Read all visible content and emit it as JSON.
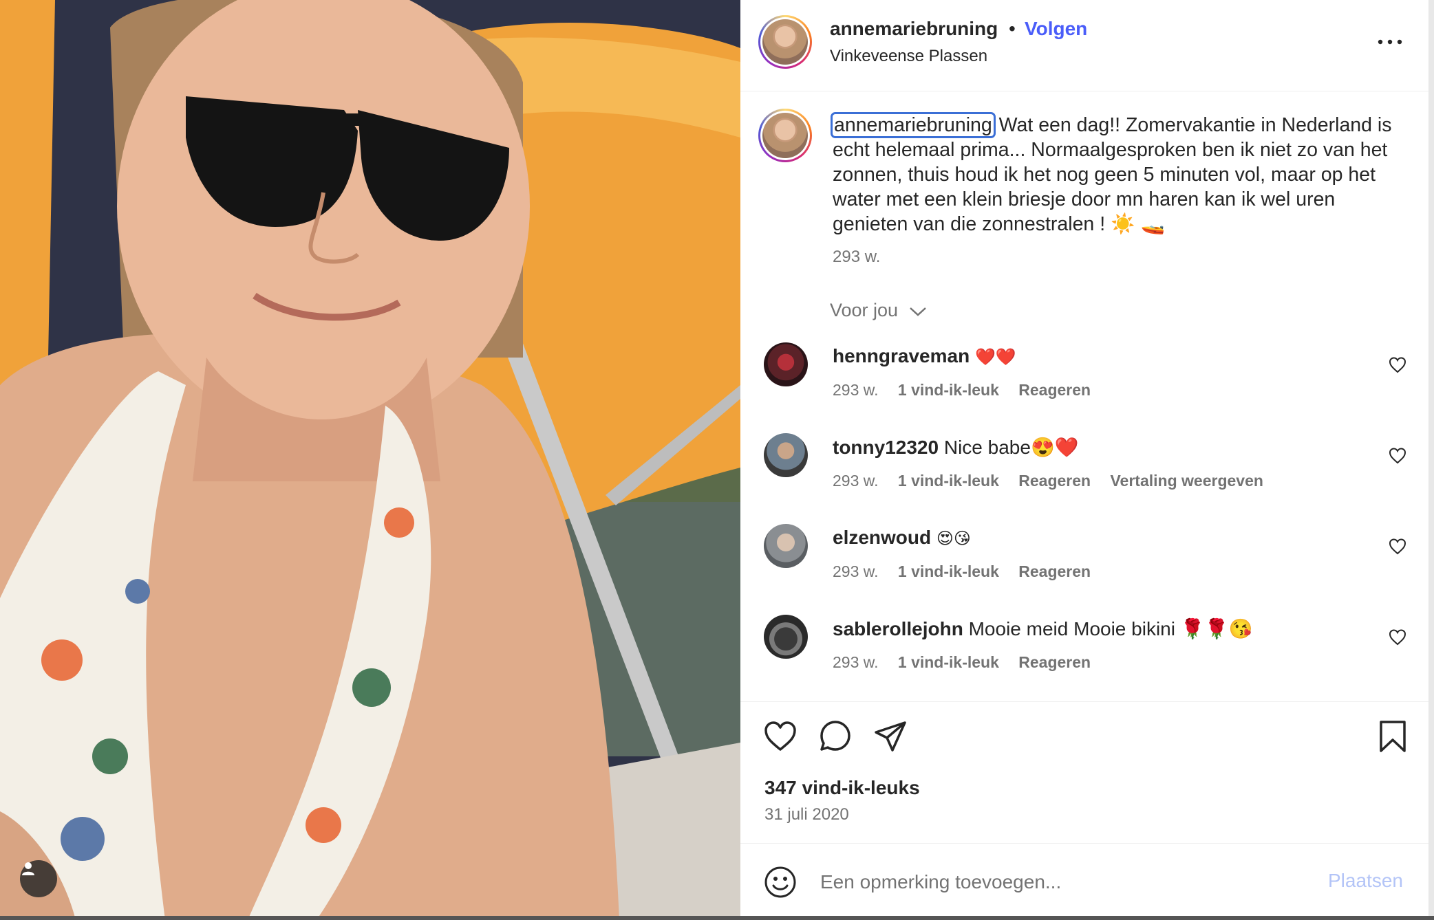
{
  "post": {
    "username": "annemariebruning",
    "separator": "•",
    "follow_label": "Volgen",
    "location": "Vinkeveense Plassen",
    "caption": "Wat een dag!! Zomervakantie in Nederland is echt helemaal prima... Normaalgesproken ben ik niet zo van het zonnen, thuis houd ik het nog geen 5 minuten vol, maar op het water met een klein briesje door mn haren kan ik wel uren genieten van die zonnestralen ! ☀️ 🚤",
    "caption_time": "293 w.",
    "for_you_label": "Voor jou",
    "likes": "347 vind-ik-leuks",
    "date": "31 juli 2020"
  },
  "comments": [
    {
      "user": "henngraveman",
      "text": "❤️❤️",
      "time": "293 w.",
      "likes": "1 vind-ik-leuk",
      "reply": "Reageren",
      "translate": ""
    },
    {
      "user": "tonny12320",
      "text": "Nice babe😍❤️",
      "time": "293 w.",
      "likes": "1 vind-ik-leuk",
      "reply": "Reageren",
      "translate": "Vertaling weergeven"
    },
    {
      "user": "elzenwoud",
      "text": "😍😘",
      "time": "293 w.",
      "likes": "1 vind-ik-leuk",
      "reply": "Reageren",
      "translate": ""
    },
    {
      "user": "sablerollejohn",
      "text": "Mooie meid Mooie bikini 🌹🌹😘",
      "time": "293 w.",
      "likes": "1 vind-ik-leuk",
      "reply": "Reageren",
      "translate": ""
    }
  ],
  "add_comment": {
    "placeholder": "Een opmerking toevoegen...",
    "post_label": "Plaatsen"
  },
  "icons": {
    "more": "more-horizontal-icon",
    "like": "heart-icon",
    "comment": "comment-bubble-icon",
    "share": "paper-plane-icon",
    "save": "bookmark-icon",
    "emoji": "smiley-icon",
    "user_tag": "user-icon"
  },
  "colors": {
    "follow": "#4a5df9",
    "post_disabled": "#b3c4f7",
    "text": "#262626",
    "secondary": "#737373"
  }
}
